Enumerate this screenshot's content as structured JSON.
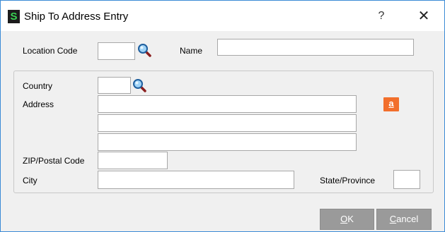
{
  "window": {
    "title": "Ship To Address Entry",
    "app_icon_letter": "S",
    "help_glyph": "?",
    "close_glyph": "✕"
  },
  "fields": {
    "location_code": {
      "label": "Location Code",
      "value": ""
    },
    "name": {
      "label": "Name",
      "value": ""
    },
    "country": {
      "label": "Country",
      "value": ""
    },
    "address": {
      "label": "Address",
      "lines": [
        "",
        "",
        ""
      ]
    },
    "zip": {
      "label": "ZIP/Postal Code",
      "value": ""
    },
    "city": {
      "label": "City",
      "value": ""
    },
    "state": {
      "label": "State/Province",
      "value": ""
    }
  },
  "icons": {
    "lookup": "magnifier-icon",
    "address_service": "amazon-icon",
    "address_service_letter": "a"
  },
  "buttons": {
    "ok": {
      "mnemonic": "O",
      "rest": "K"
    },
    "cancel": {
      "mnemonic": "C",
      "rest": "ancel"
    }
  },
  "colors": {
    "window_border": "#3b8bd6",
    "dialog_bg": "#f0f0f0",
    "app_icon_bg": "#1c1c1c",
    "app_icon_fg": "#39d353",
    "amazon_button": "#f26f2c",
    "button_bg": "#9a9a9a"
  }
}
